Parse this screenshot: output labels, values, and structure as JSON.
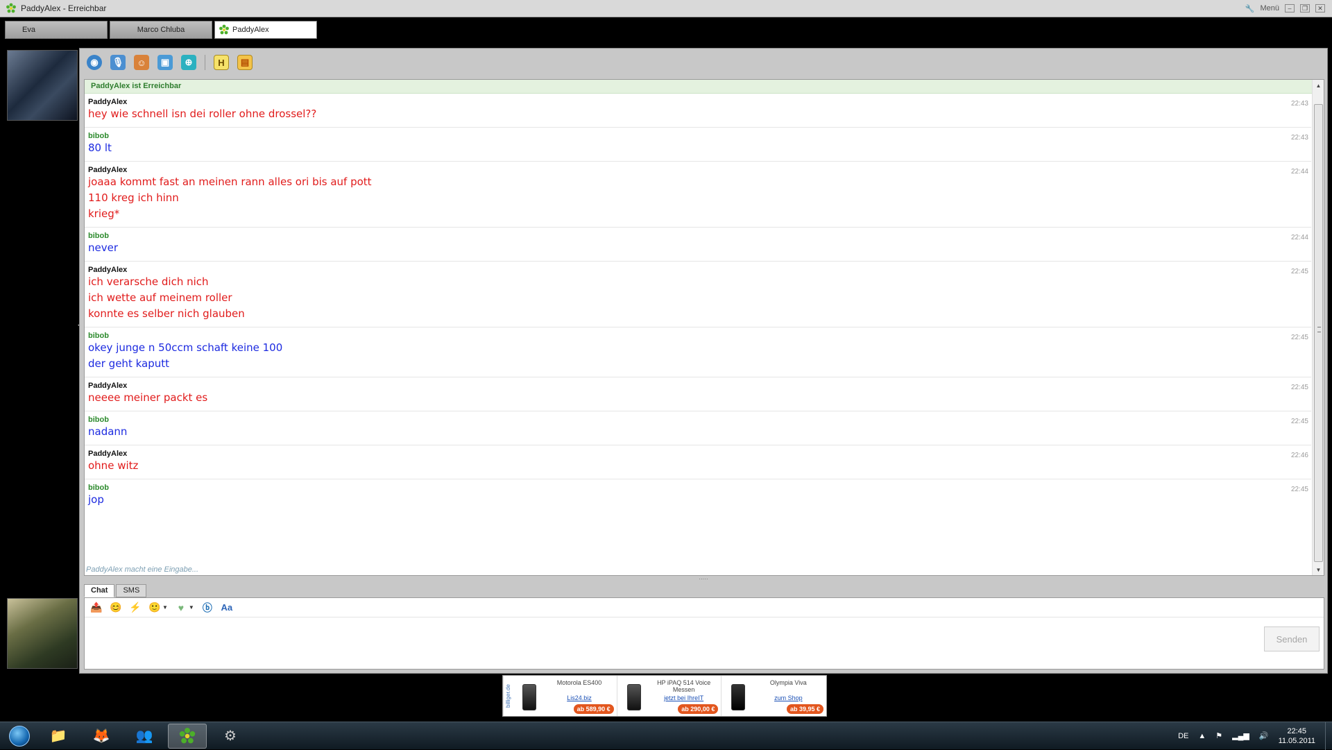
{
  "window": {
    "title": "PaddyAlex - Erreichbar",
    "menu_label": "Menü",
    "minimize_glyph": "–",
    "restore_glyph": "❐",
    "close_glyph": "✕"
  },
  "contact_tabs": [
    {
      "label": "Eva"
    },
    {
      "label": "Marco Chluba"
    },
    {
      "label": "PaddyAlex"
    }
  ],
  "toolbar": {
    "icons": [
      "webcam-icon",
      "microphone-icon",
      "contacts-icon",
      "window-icon",
      "gamepad-icon",
      "history-icon",
      "profile-card-icon"
    ],
    "history_letter": "H"
  },
  "chat": {
    "status": "PaddyAlex ist Erreichbar",
    "messages": [
      {
        "sender": "PaddyAlex",
        "time": "22:43",
        "lines": [
          "hey wie schnell isn dei roller ohne drossel??"
        ]
      },
      {
        "sender": "bibob",
        "time": "22:43",
        "lines": [
          "80 lt"
        ]
      },
      {
        "sender": "PaddyAlex",
        "time": "22:44",
        "lines": [
          "joaaa kommt fast an meinen rann alles ori bis auf pott",
          "110 kreg ich hinn",
          "krieg*"
        ]
      },
      {
        "sender": "bibob",
        "time": "22:44",
        "lines": [
          "never"
        ]
      },
      {
        "sender": "PaddyAlex",
        "time": "22:45",
        "lines": [
          "ich verarsche dich nich",
          "ich wette auf meinem roller",
          "konnte es selber nich glauben"
        ]
      },
      {
        "sender": "bibob",
        "time": "22:45",
        "lines": [
          "okey junge n 50ccm schaft keine 100",
          "der geht kaputt"
        ]
      },
      {
        "sender": "PaddyAlex",
        "time": "22:45",
        "lines": [
          "neeee meiner packt es"
        ]
      },
      {
        "sender": "bibob",
        "time": "22:45",
        "lines": [
          "nadann"
        ]
      },
      {
        "sender": "PaddyAlex",
        "time": "22:46",
        "lines": [
          "ohne witz"
        ]
      },
      {
        "sender": "bibob",
        "time": "22:45",
        "lines": [
          "jop"
        ]
      }
    ],
    "typing_notice": "PaddyAlex macht eine Eingabe..."
  },
  "input": {
    "tabs": [
      "Chat",
      "SMS"
    ],
    "send_label": "Senden",
    "format_icons": [
      "send-file-icon",
      "smiley-icon",
      "lightning-icon",
      "animation-icon",
      "heart-icon",
      "bold-icon",
      "font-icon"
    ]
  },
  "ad": {
    "side_label": "billiger.de",
    "items": [
      {
        "name": "Motorola ES400",
        "shop": "Lis24.biz",
        "price": "ab 589,90 €"
      },
      {
        "name": "HP iPAQ 514 Voice Messen",
        "shop": "jetzt bei IhreIT",
        "price": "ab 290,00 €"
      },
      {
        "name": "Olympia Viva",
        "shop": "zum Shop",
        "price": "ab 39,95 €"
      }
    ]
  },
  "taskbar": {
    "apps": [
      "explorer-icon",
      "firefox-icon",
      "messenger-icon",
      "icq-icon",
      "steam-icon"
    ],
    "language": "DE",
    "time": "22:45",
    "date": "11.05.2011"
  }
}
